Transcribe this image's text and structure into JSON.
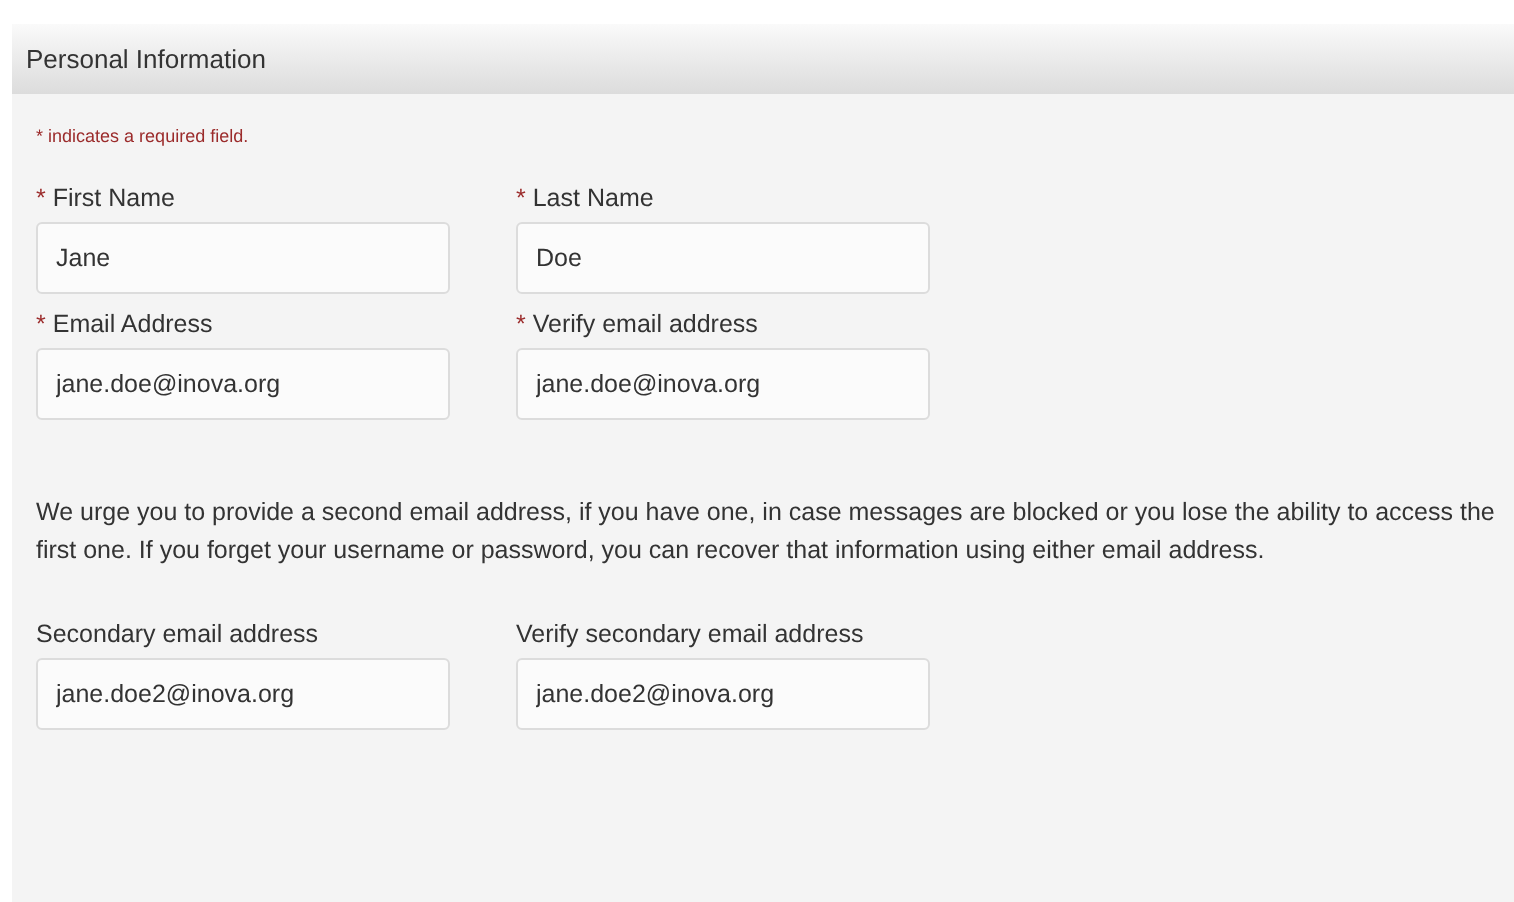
{
  "panel": {
    "title": "Personal Information"
  },
  "required_note": {
    "marker": "*",
    "text": "indicates a required field."
  },
  "field_rows": [
    [
      {
        "label": "First Name",
        "value": "Jane",
        "required": true
      },
      {
        "label": "Last Name",
        "value": "Doe",
        "required": true
      }
    ],
    [
      {
        "label": "Email Address",
        "value": "jane.doe@inova.org",
        "required": true
      },
      {
        "label": "Verify email address",
        "value": "jane.doe@inova.org",
        "required": true
      }
    ]
  ],
  "notice": "We urge you to provide a second email address, if you have one, in case messages are blocked or you lose the ability to access the first one. If you forget your username or password, you can recover that information using either email address.",
  "secondary_rows": [
    [
      {
        "label": "Secondary email address",
        "value": "jane.doe2@inova.org",
        "required": false
      },
      {
        "label": "Verify secondary email address",
        "value": "jane.doe2@inova.org",
        "required": false
      }
    ]
  ]
}
